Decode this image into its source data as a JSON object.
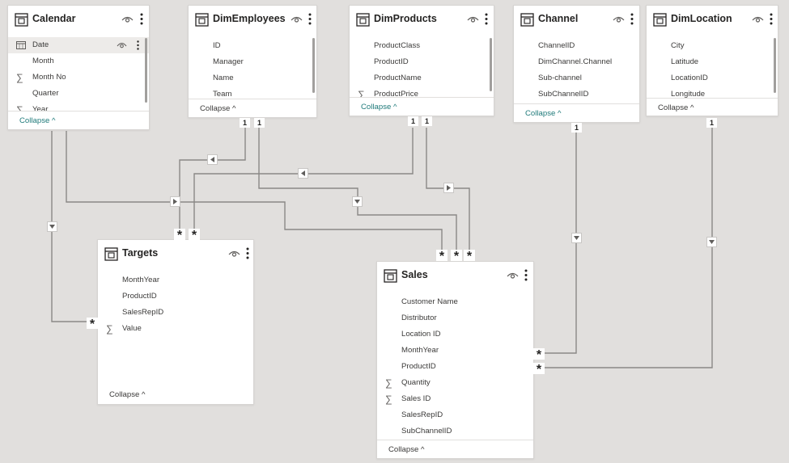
{
  "tables": {
    "calendar": {
      "title": "Calendar",
      "fields": [
        {
          "name": "Date",
          "icon": "calendar-icon"
        },
        {
          "name": "Month",
          "icon": ""
        },
        {
          "name": "Month No",
          "icon": "sigma-icon"
        },
        {
          "name": "Quarter",
          "icon": ""
        },
        {
          "name": "Year",
          "icon": "sigma-icon"
        }
      ],
      "collapse": "Collapse ^"
    },
    "dimemployees": {
      "title": "DimEmployees",
      "fields": [
        {
          "name": "ID",
          "icon": ""
        },
        {
          "name": "Manager",
          "icon": ""
        },
        {
          "name": "Name",
          "icon": ""
        },
        {
          "name": "Team",
          "icon": ""
        }
      ],
      "collapse": "Collapse ^"
    },
    "dimproducts": {
      "title": "DimProducts",
      "fields": [
        {
          "name": "ProductClass",
          "icon": ""
        },
        {
          "name": "ProductID",
          "icon": ""
        },
        {
          "name": "ProductName",
          "icon": ""
        },
        {
          "name": "ProductPrice",
          "icon": "sigma-icon"
        }
      ],
      "collapse": "Collapse ^"
    },
    "channel": {
      "title": "Channel",
      "fields": [
        {
          "name": "ChannelID",
          "icon": ""
        },
        {
          "name": "DimChannel.Channel",
          "icon": ""
        },
        {
          "name": "Sub-channel",
          "icon": ""
        },
        {
          "name": "SubChannelID",
          "icon": ""
        }
      ],
      "collapse": "Collapse ^"
    },
    "dimlocation": {
      "title": "DimLocation",
      "fields": [
        {
          "name": "City",
          "icon": ""
        },
        {
          "name": "Latitude",
          "icon": ""
        },
        {
          "name": "LocationID",
          "icon": ""
        },
        {
          "name": "Longitude",
          "icon": ""
        }
      ],
      "collapse": "Collapse ^"
    },
    "targets": {
      "title": "Targets",
      "fields": [
        {
          "name": "MonthYear",
          "icon": ""
        },
        {
          "name": "ProductID",
          "icon": ""
        },
        {
          "name": "SalesRepID",
          "icon": ""
        },
        {
          "name": "Value",
          "icon": "sigma-icon"
        }
      ],
      "collapse": "Collapse ^"
    },
    "sales": {
      "title": "Sales",
      "fields": [
        {
          "name": "Customer Name",
          "icon": ""
        },
        {
          "name": "Distributor",
          "icon": ""
        },
        {
          "name": "Location ID",
          "icon": ""
        },
        {
          "name": "MonthYear",
          "icon": ""
        },
        {
          "name": "ProductID",
          "icon": ""
        },
        {
          "name": "Quantity",
          "icon": "sigma-icon"
        },
        {
          "name": "Sales ID",
          "icon": "sigma-icon"
        },
        {
          "name": "SalesRepID",
          "icon": ""
        },
        {
          "name": "SubChannelID",
          "icon": ""
        }
      ],
      "collapse": "Collapse ^"
    }
  },
  "cardinality": {
    "one": "1",
    "many": "*"
  },
  "colors": {
    "canvas": "#e1dfdd",
    "card": "#ffffff",
    "line": "#8a8886",
    "collapse_teal": "#1f7a7a"
  }
}
